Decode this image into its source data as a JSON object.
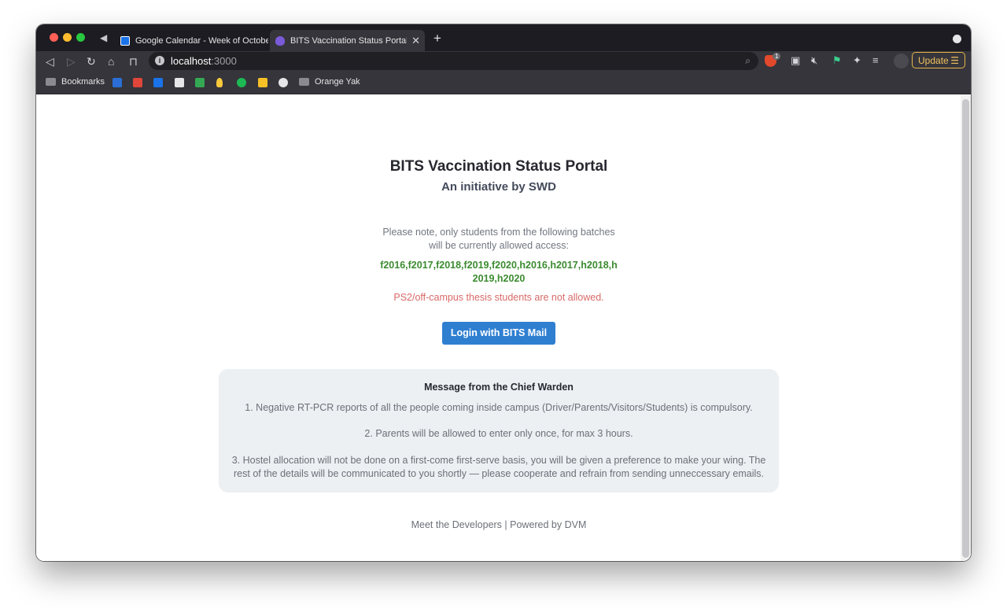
{
  "browser": {
    "tabs": [
      {
        "title": "Google Calendar - Week of October",
        "active": false
      },
      {
        "title": "BITS Vaccination Status Portal",
        "active": true
      }
    ],
    "new_tab_label": "+",
    "url_host": "localhost",
    "url_port": ":3000",
    "update_label": "Update",
    "brave_badge": "1",
    "bookmarks": {
      "folder_label": "Bookmarks",
      "other_folder_label": "Orange Yak"
    }
  },
  "page": {
    "title": "BITS Vaccination Status Portal",
    "subtitle": "An initiative by SWD",
    "note": "Please note, only students from the following batches will be currently allowed access:",
    "batches": "f2016,f2017,f2018,f2019,f2020,h2016,h2017,h2018,h2019,h2020",
    "warning": "PS2/off-campus thesis students are not allowed.",
    "login_label": "Login with BITS Mail",
    "message": {
      "title": "Message from the Chief Warden",
      "items": [
        "1. Negative RT-PCR reports of all the people coming inside campus (Driver/Parents/Visitors/Students) is compulsory.",
        "2. Parents will be allowed to enter only once, for max 3 hours.",
        "3. Hostel allocation will not be done on a first-come first-serve basis, you will be given a preference to make your wing. The rest of the details will be communicated to you shortly — please cooperate and refrain from sending unneccessary emails."
      ]
    },
    "footer": "Meet the Developers | Powered by DVM"
  },
  "colors": {
    "accent": "#2f7fd1",
    "batch_green": "#3b8b2f",
    "warning_red": "#d86a68",
    "message_bg": "#ecf0f3"
  }
}
